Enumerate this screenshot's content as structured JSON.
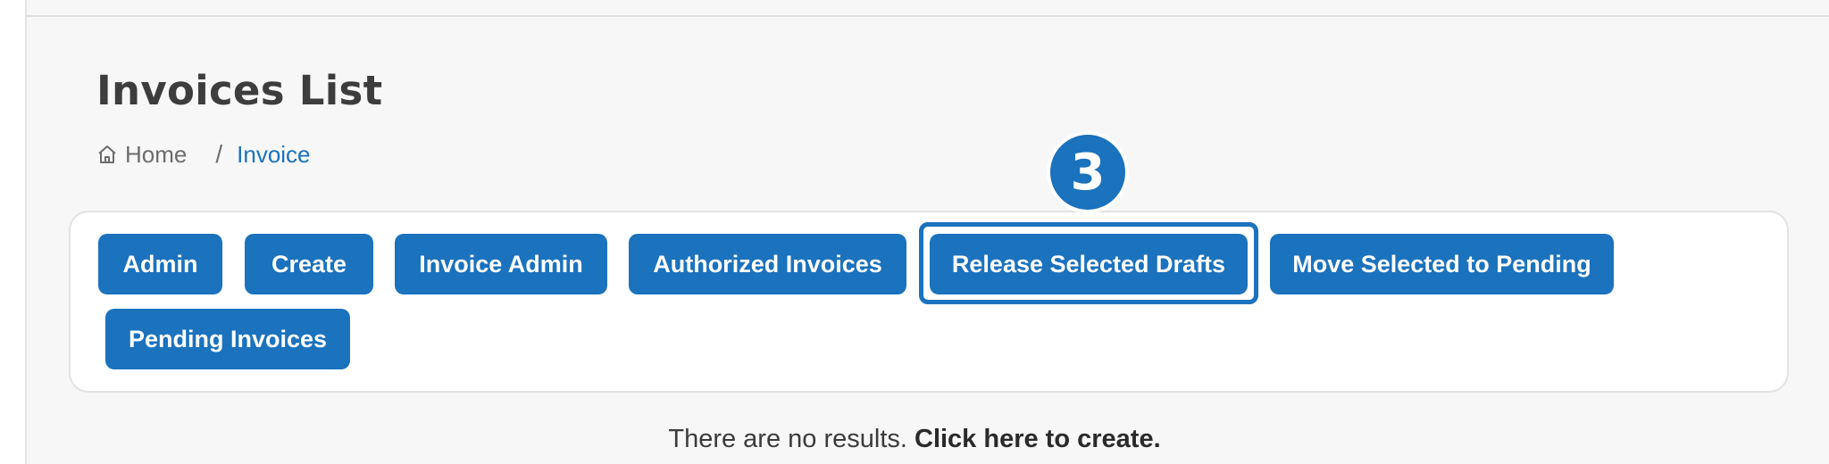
{
  "page": {
    "title": "Invoices List"
  },
  "breadcrumb": {
    "home_label": "Home",
    "separator": "/",
    "current": "Invoice"
  },
  "toolbar": {
    "buttons": [
      {
        "label": "Admin"
      },
      {
        "label": "Create"
      },
      {
        "label": "Invoice Admin"
      },
      {
        "label": "Authorized Invoices"
      },
      {
        "label": "Release Selected Drafts"
      },
      {
        "label": "Move Selected to Pending"
      },
      {
        "label": "Pending Invoices"
      }
    ]
  },
  "annotation": {
    "step_number": "3"
  },
  "empty_state": {
    "message": "There are no results.",
    "link_text": "Click here to create."
  },
  "colors": {
    "accent": "#1b72bd",
    "background": "#f7f7f7",
    "panel": "#ffffff"
  },
  "icons": {
    "home": "home-icon"
  }
}
